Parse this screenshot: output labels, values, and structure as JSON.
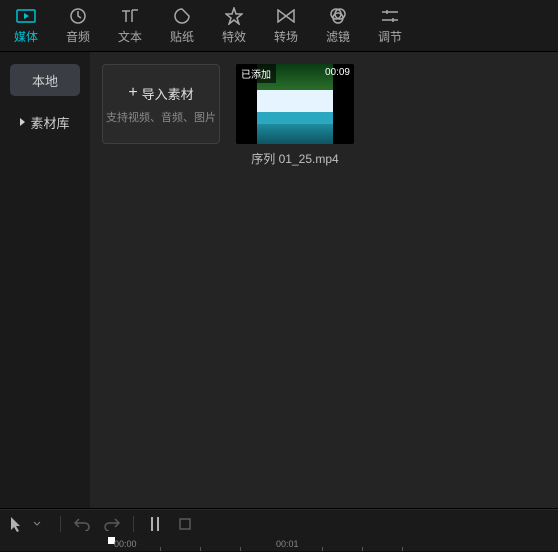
{
  "tabs": {
    "media": "媒体",
    "audio": "音频",
    "text": "文本",
    "sticker": "贴纸",
    "effect": "特效",
    "transition": "转场",
    "filter": "滤镜",
    "adjust": "调节"
  },
  "sidebar": {
    "local": "本地",
    "library": "素材库"
  },
  "import": {
    "title": "导入素材",
    "subtitle": "支持视频、音频、图片"
  },
  "clip": {
    "badge": "已添加",
    "duration": "00:09",
    "filename": "序列 01_25.mp4"
  },
  "timeline": {
    "t0": "00:00",
    "t1": "00:01"
  }
}
